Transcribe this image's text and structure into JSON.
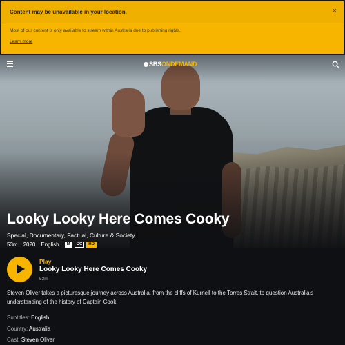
{
  "alert": {
    "title": "Content may be unavailable in your location.",
    "close": "×",
    "body": "Most of our content is only available to stream within Australia due to publishing rights.",
    "link": "Learn more"
  },
  "nav": {
    "logo_sbs": "SBS",
    "logo_on": "ON",
    "logo_demand": "DEMAND"
  },
  "program": {
    "title": "Looky Looky Here Comes Cooky",
    "genres": "Special, Documentary, Factual, Culture & Society",
    "duration": "53m",
    "year": "2020",
    "language": "English",
    "badges": [
      "M",
      "CC",
      "HD"
    ],
    "play_label": "Play",
    "play_title": "Looky Looky Here Comes Cooky",
    "play_duration": "52m",
    "description": "Steven Oliver takes a picturesque journey across Australia, from the cliffs of Kurnell to the Torres Strait, to question Australia's understanding of the history of Captain Cook.",
    "subtitles_label": "Subtitles:",
    "subtitles_value": "English",
    "country_label": "Country:",
    "country_value": "Australia",
    "cast_label": "Cast:",
    "cast_value": "Steven Oliver"
  },
  "colors": {
    "accent": "#f7b500",
    "background": "#0f1013"
  },
  "icons": {
    "menu": "hamburger-icon",
    "search": "search-icon",
    "close": "close-icon",
    "play": "play-icon"
  }
}
